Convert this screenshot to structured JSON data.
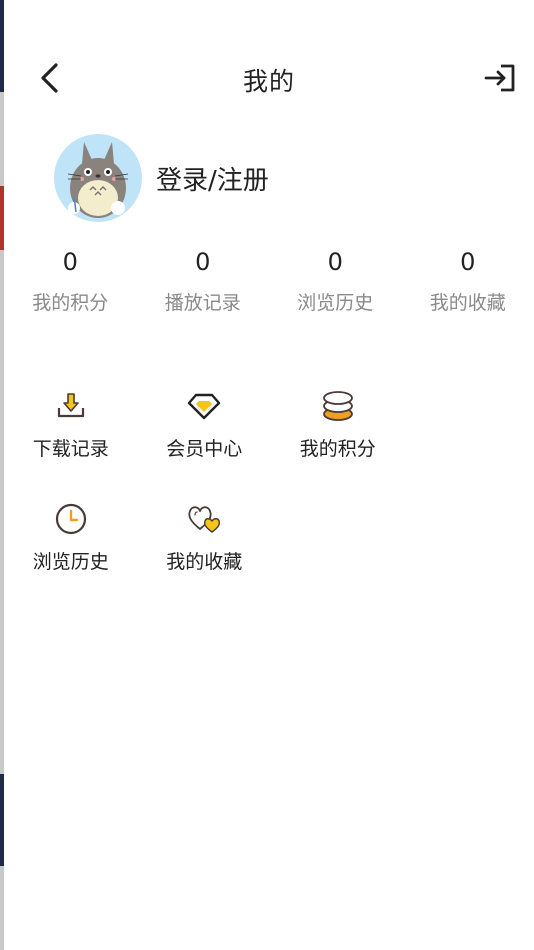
{
  "header": {
    "title": "我的"
  },
  "profile": {
    "login_label": "登录/注册"
  },
  "stats": [
    {
      "value": "0",
      "label": "我的积分"
    },
    {
      "value": "0",
      "label": "播放记录"
    },
    {
      "value": "0",
      "label": "浏览历史"
    },
    {
      "value": "0",
      "label": "我的收藏"
    }
  ],
  "menu": [
    {
      "label": "下载记录",
      "icon": "download-icon"
    },
    {
      "label": "会员中心",
      "icon": "diamond-icon"
    },
    {
      "label": "我的积分",
      "icon": "coins-icon"
    },
    {
      "label": "浏览历史",
      "icon": "clock-icon"
    },
    {
      "label": "我的收藏",
      "icon": "hearts-icon"
    }
  ],
  "colors": {
    "accent_yellow": "#f5c518",
    "accent_orange": "#f0a020",
    "icon_dark": "#4a3b38"
  }
}
